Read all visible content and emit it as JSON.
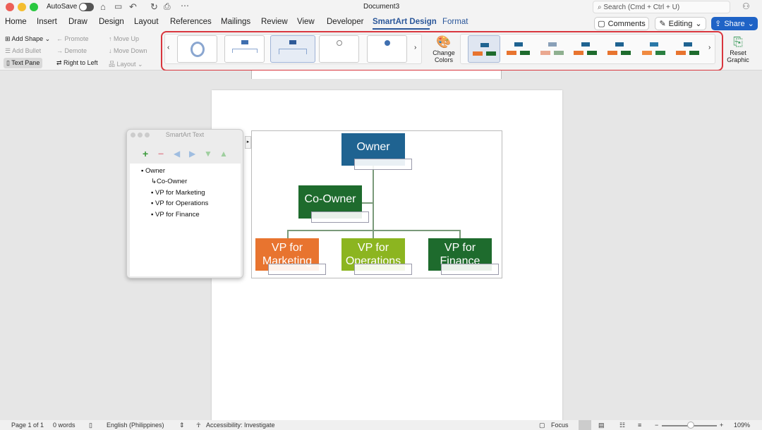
{
  "window": {
    "title": "Document3",
    "autosave_label": "AutoSave",
    "search_placeholder": "Search (Cmd + Ctrl + U)"
  },
  "tabs": [
    "Home",
    "Insert",
    "Draw",
    "Design",
    "Layout",
    "References",
    "Mailings",
    "Review",
    "View",
    "Developer",
    "SmartArt Design",
    "Format"
  ],
  "active_tab": "SmartArt Design",
  "header_buttons": {
    "comments": "Comments",
    "editing": "Editing",
    "share": "Share"
  },
  "ribbon": {
    "add_shape": "Add Shape",
    "add_bullet": "Add Bullet",
    "text_pane": "Text Pane",
    "promote": "Promote",
    "demote": "Demote",
    "right_to_left": "Right to Left",
    "move_up": "Move Up",
    "move_down": "Move Down",
    "layout": "Layout",
    "change_colors": "Change Colors",
    "reset_graphic": "Reset Graphic",
    "highlight_color": "#d9363e"
  },
  "smartart": {
    "nodes": {
      "owner": "Owner",
      "co_owner": "Co-Owner",
      "vp_marketing": "VP for Marketing",
      "vp_operations": "VP for Operations",
      "vp_finance": "VP for Finance"
    },
    "colors": {
      "owner": "#1f6391",
      "co_owner": "#1e6b2d",
      "marketing": "#e8742f",
      "operations": "#8cb520",
      "finance": "#1e6b2d"
    }
  },
  "text_pane": {
    "title": "SmartArt Text",
    "items": [
      "Owner",
      "Co-Owner",
      "VP for Marketing",
      "VP for Operations",
      "VP for Finance"
    ]
  },
  "status": {
    "page": "Page 1 of 1",
    "words": "0 words",
    "language": "English (Philippines)",
    "accessibility": "Accessibility: Investigate",
    "focus": "Focus",
    "zoom": "109%",
    "zoom_value_percent": 109
  }
}
